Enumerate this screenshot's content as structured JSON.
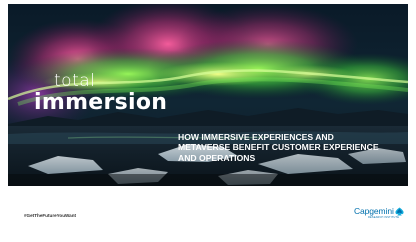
{
  "slide": {
    "title_small": "total",
    "title_big": "immersion",
    "subtitle_lines": [
      "HOW IMMERSIVE EXPERIENCES AND",
      "METAVERSE BENEFIT CUSTOMER EXPERIENCE",
      "AND OPERATIONS"
    ],
    "hashtag": "#GetTheFutureYouWant"
  },
  "logo": {
    "name": "Capgemini",
    "sub": "RESEARCH INSTITUTE",
    "color": "#0070ad"
  },
  "hero_image": {
    "icon": "aurora-borealis-photo"
  }
}
